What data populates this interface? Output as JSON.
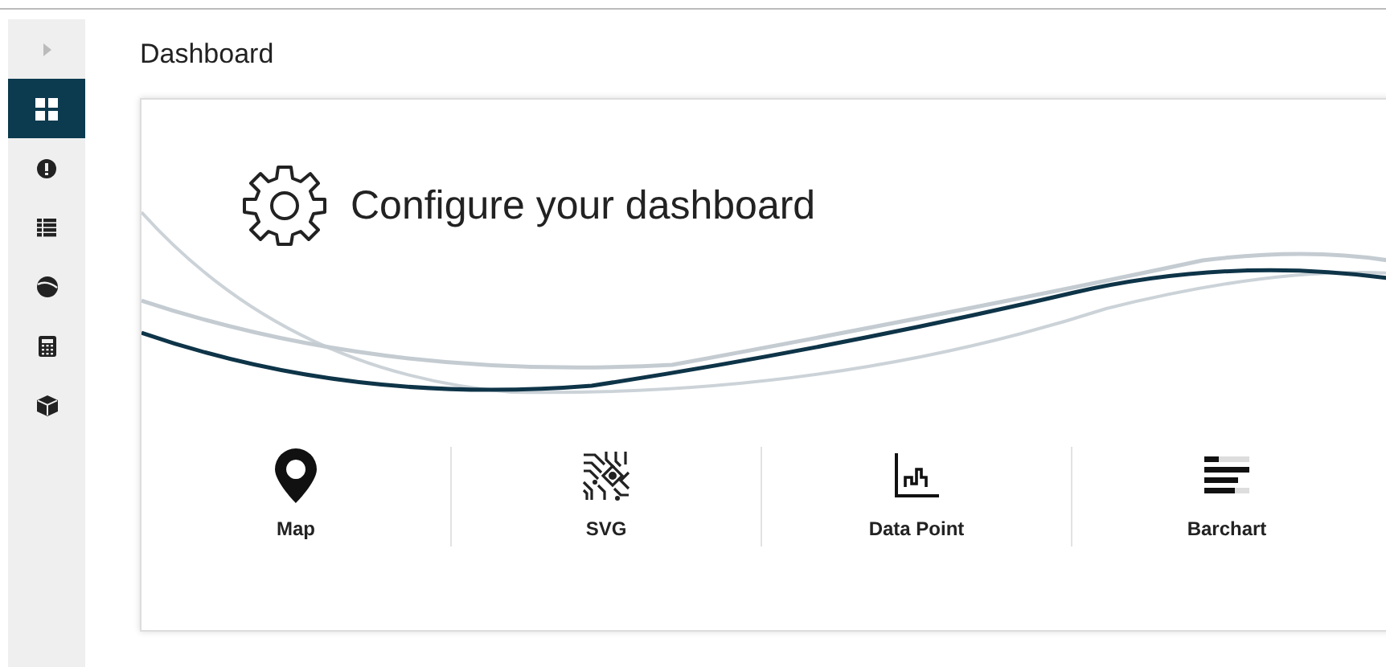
{
  "sidebar": {
    "items": [
      {
        "selected": true
      },
      {
        "selected": false
      },
      {
        "selected": false
      },
      {
        "selected": false
      },
      {
        "selected": false
      },
      {
        "selected": false
      }
    ]
  },
  "page": {
    "title": "Dashboard"
  },
  "card": {
    "title": "Configure your dashboard",
    "widgets": [
      {
        "label": "Map"
      },
      {
        "label": "SVG"
      },
      {
        "label": "Data Point"
      },
      {
        "label": "Barchart"
      }
    ]
  }
}
